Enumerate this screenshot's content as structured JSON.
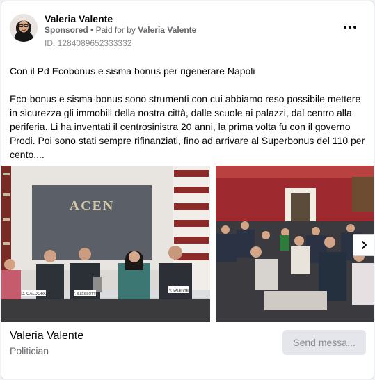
{
  "post": {
    "author_name": "Valeria Valente",
    "sponsored_label": "Sponsored",
    "separator": "•",
    "paid_for_prefix": "Paid for by",
    "paid_for_name": "Valeria Valente",
    "ad_id": "ID: 1284089652333332",
    "more_icon": "more-horizontal-icon"
  },
  "body": {
    "headline": "Con il Pd Ecobonus e sisma bonus per rigenerare Napoli",
    "paragraph": "Eco-bonus e sisma-bonus sono strumenti con cui abbiamo reso possibile mettere in sicurezza gli immobili della nostra città, dalle scuole ai palazzi, dal centro alla periferia. Li ha inventati il centrosinistra 20 anni, la prima volta fu con il governo Prodi. Poi sono stati sempre rifinanziati, fino ad arrivare al Superbonus del 110 per cento...."
  },
  "carousel": {
    "photo1": {
      "wall_sign": "ACEN",
      "name_cards": [
        "D. CALDORO",
        "F. ILLESSOTTI",
        "V. VALENTE"
      ]
    },
    "next_icon": "chevron-right-icon"
  },
  "footer": {
    "name": "Valeria Valente",
    "subtitle": "Politician",
    "send_label": "Send messa..."
  },
  "colors": {
    "text_primary": "#050505",
    "text_secondary": "#65676b",
    "card_border": "#dddfe2",
    "room_red": "#9e2a2f",
    "button_bg": "#e4e6eb"
  }
}
